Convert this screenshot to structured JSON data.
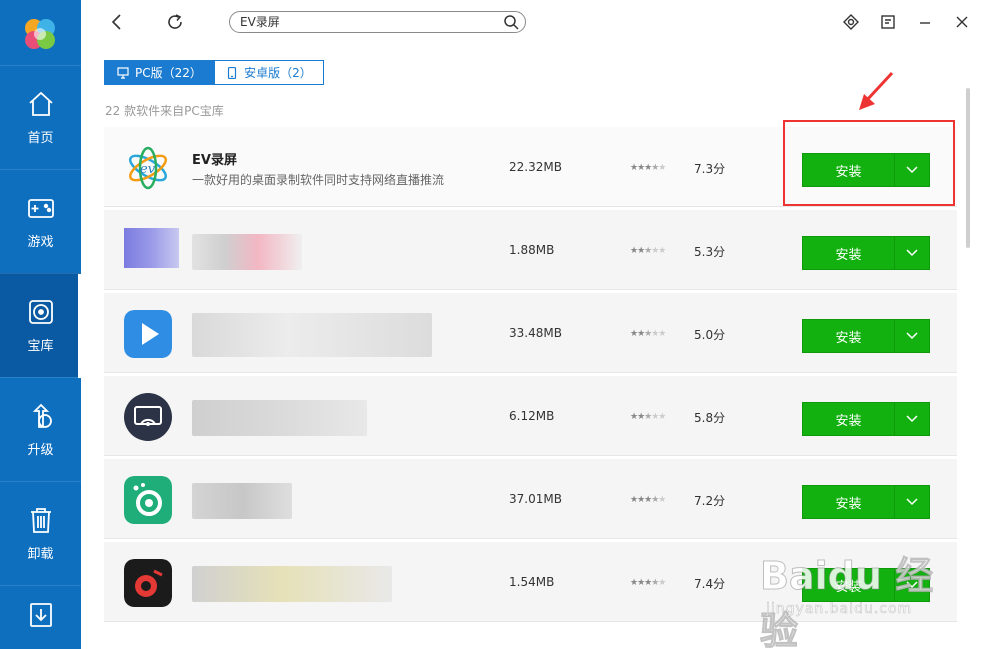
{
  "sidebar": {
    "items": [
      {
        "label": "首页",
        "icon": "home-icon"
      },
      {
        "label": "游戏",
        "icon": "gamepad-icon"
      },
      {
        "label": "宝库",
        "icon": "disc-icon",
        "active": true
      },
      {
        "label": "升级",
        "icon": "upgrade-icon"
      },
      {
        "label": "卸载",
        "icon": "trash-icon"
      },
      {
        "label": "",
        "icon": "download-icon"
      }
    ]
  },
  "topbar": {
    "search_value": "EV录屏",
    "icons": [
      "back-icon",
      "refresh-icon",
      "search-icon",
      "settings-icon",
      "mini-mode-icon",
      "minimize-icon",
      "close-icon"
    ]
  },
  "tabs": {
    "pc_label": "PC版（22）",
    "android_label": "安卓版（2）"
  },
  "source_note": "22 款软件来自PC宝库",
  "apps": [
    {
      "name": "EV录屏",
      "desc": "一款好用的桌面录制软件同时支持网络直播推流",
      "size": "22.32MB",
      "rating": 3.5,
      "score": "7.3分",
      "install_label": "安装",
      "icon": "ev-recorder-icon"
    },
    {
      "name": "",
      "desc": "",
      "size": "1.88MB",
      "rating": 2.5,
      "score": "5.3分",
      "install_label": "安装",
      "icon": "blurred-app-icon"
    },
    {
      "name": "",
      "desc": "",
      "size": "33.48MB",
      "rating": 2.5,
      "score": "5.0分",
      "install_label": "安装",
      "icon": "play-app-icon"
    },
    {
      "name": "",
      "desc": "",
      "size": "6.12MB",
      "rating": 2.5,
      "score": "5.8分",
      "install_label": "安装",
      "icon": "cast-app-icon"
    },
    {
      "name": "",
      "desc": "",
      "size": "37.01MB",
      "rating": 3.5,
      "score": "7.2分",
      "install_label": "安装",
      "icon": "green-recorder-icon"
    },
    {
      "name": "",
      "desc": "",
      "size": "1.54MB",
      "rating": 3.5,
      "score": "7.4分",
      "install_label": "安装",
      "icon": "red-recorder-icon"
    }
  ],
  "watermark": {
    "brand": "Baidu 经验",
    "url": "jingyan.baidu.com"
  },
  "colors": {
    "sidebar": "#0f6fbf",
    "accent": "#1a7bd0",
    "install": "#12b10f",
    "highlight": "#e33333"
  }
}
